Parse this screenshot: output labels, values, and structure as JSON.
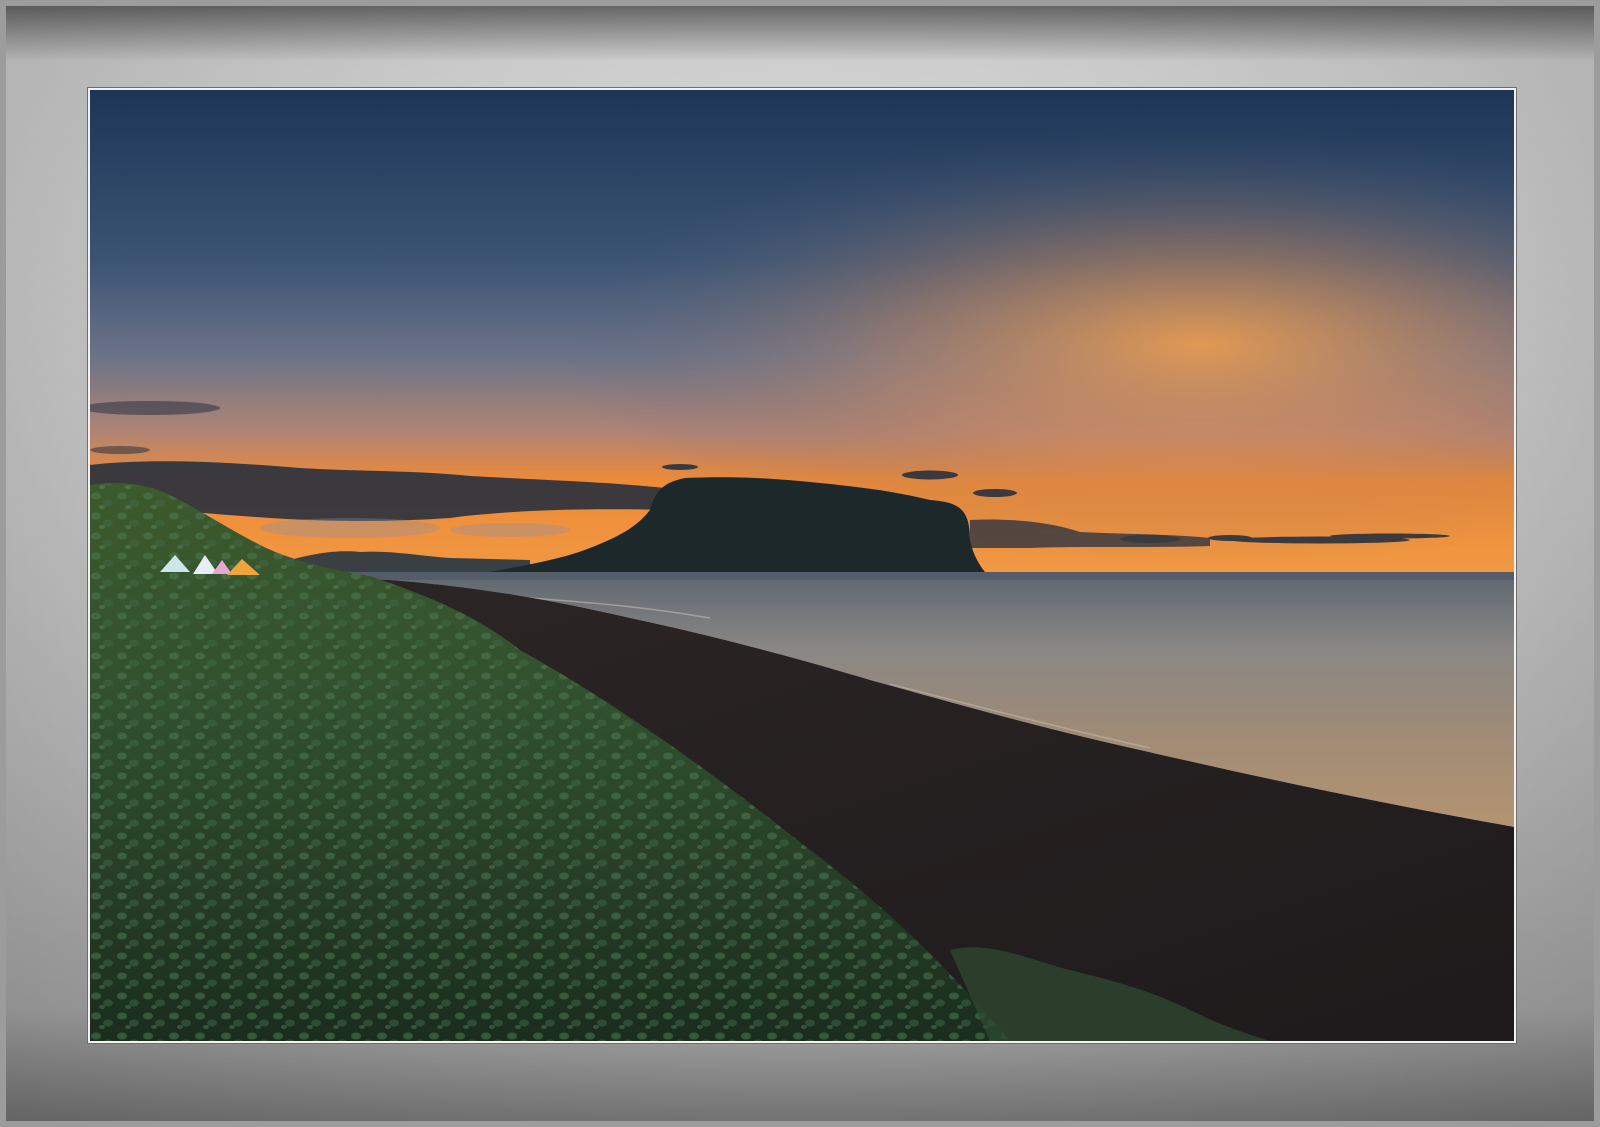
{
  "scene": {
    "subject": "coastal-sunset",
    "colors": {
      "sky_top": "#1f3a5c",
      "sky_mid": "#4f6687",
      "sky_horizon": "#f28a2e",
      "sea": "#8a8c90",
      "sand": "#2a2424",
      "grass": "#2f4a2a",
      "headland": "#1e2a2c",
      "frame": "#b5b5b5"
    }
  }
}
